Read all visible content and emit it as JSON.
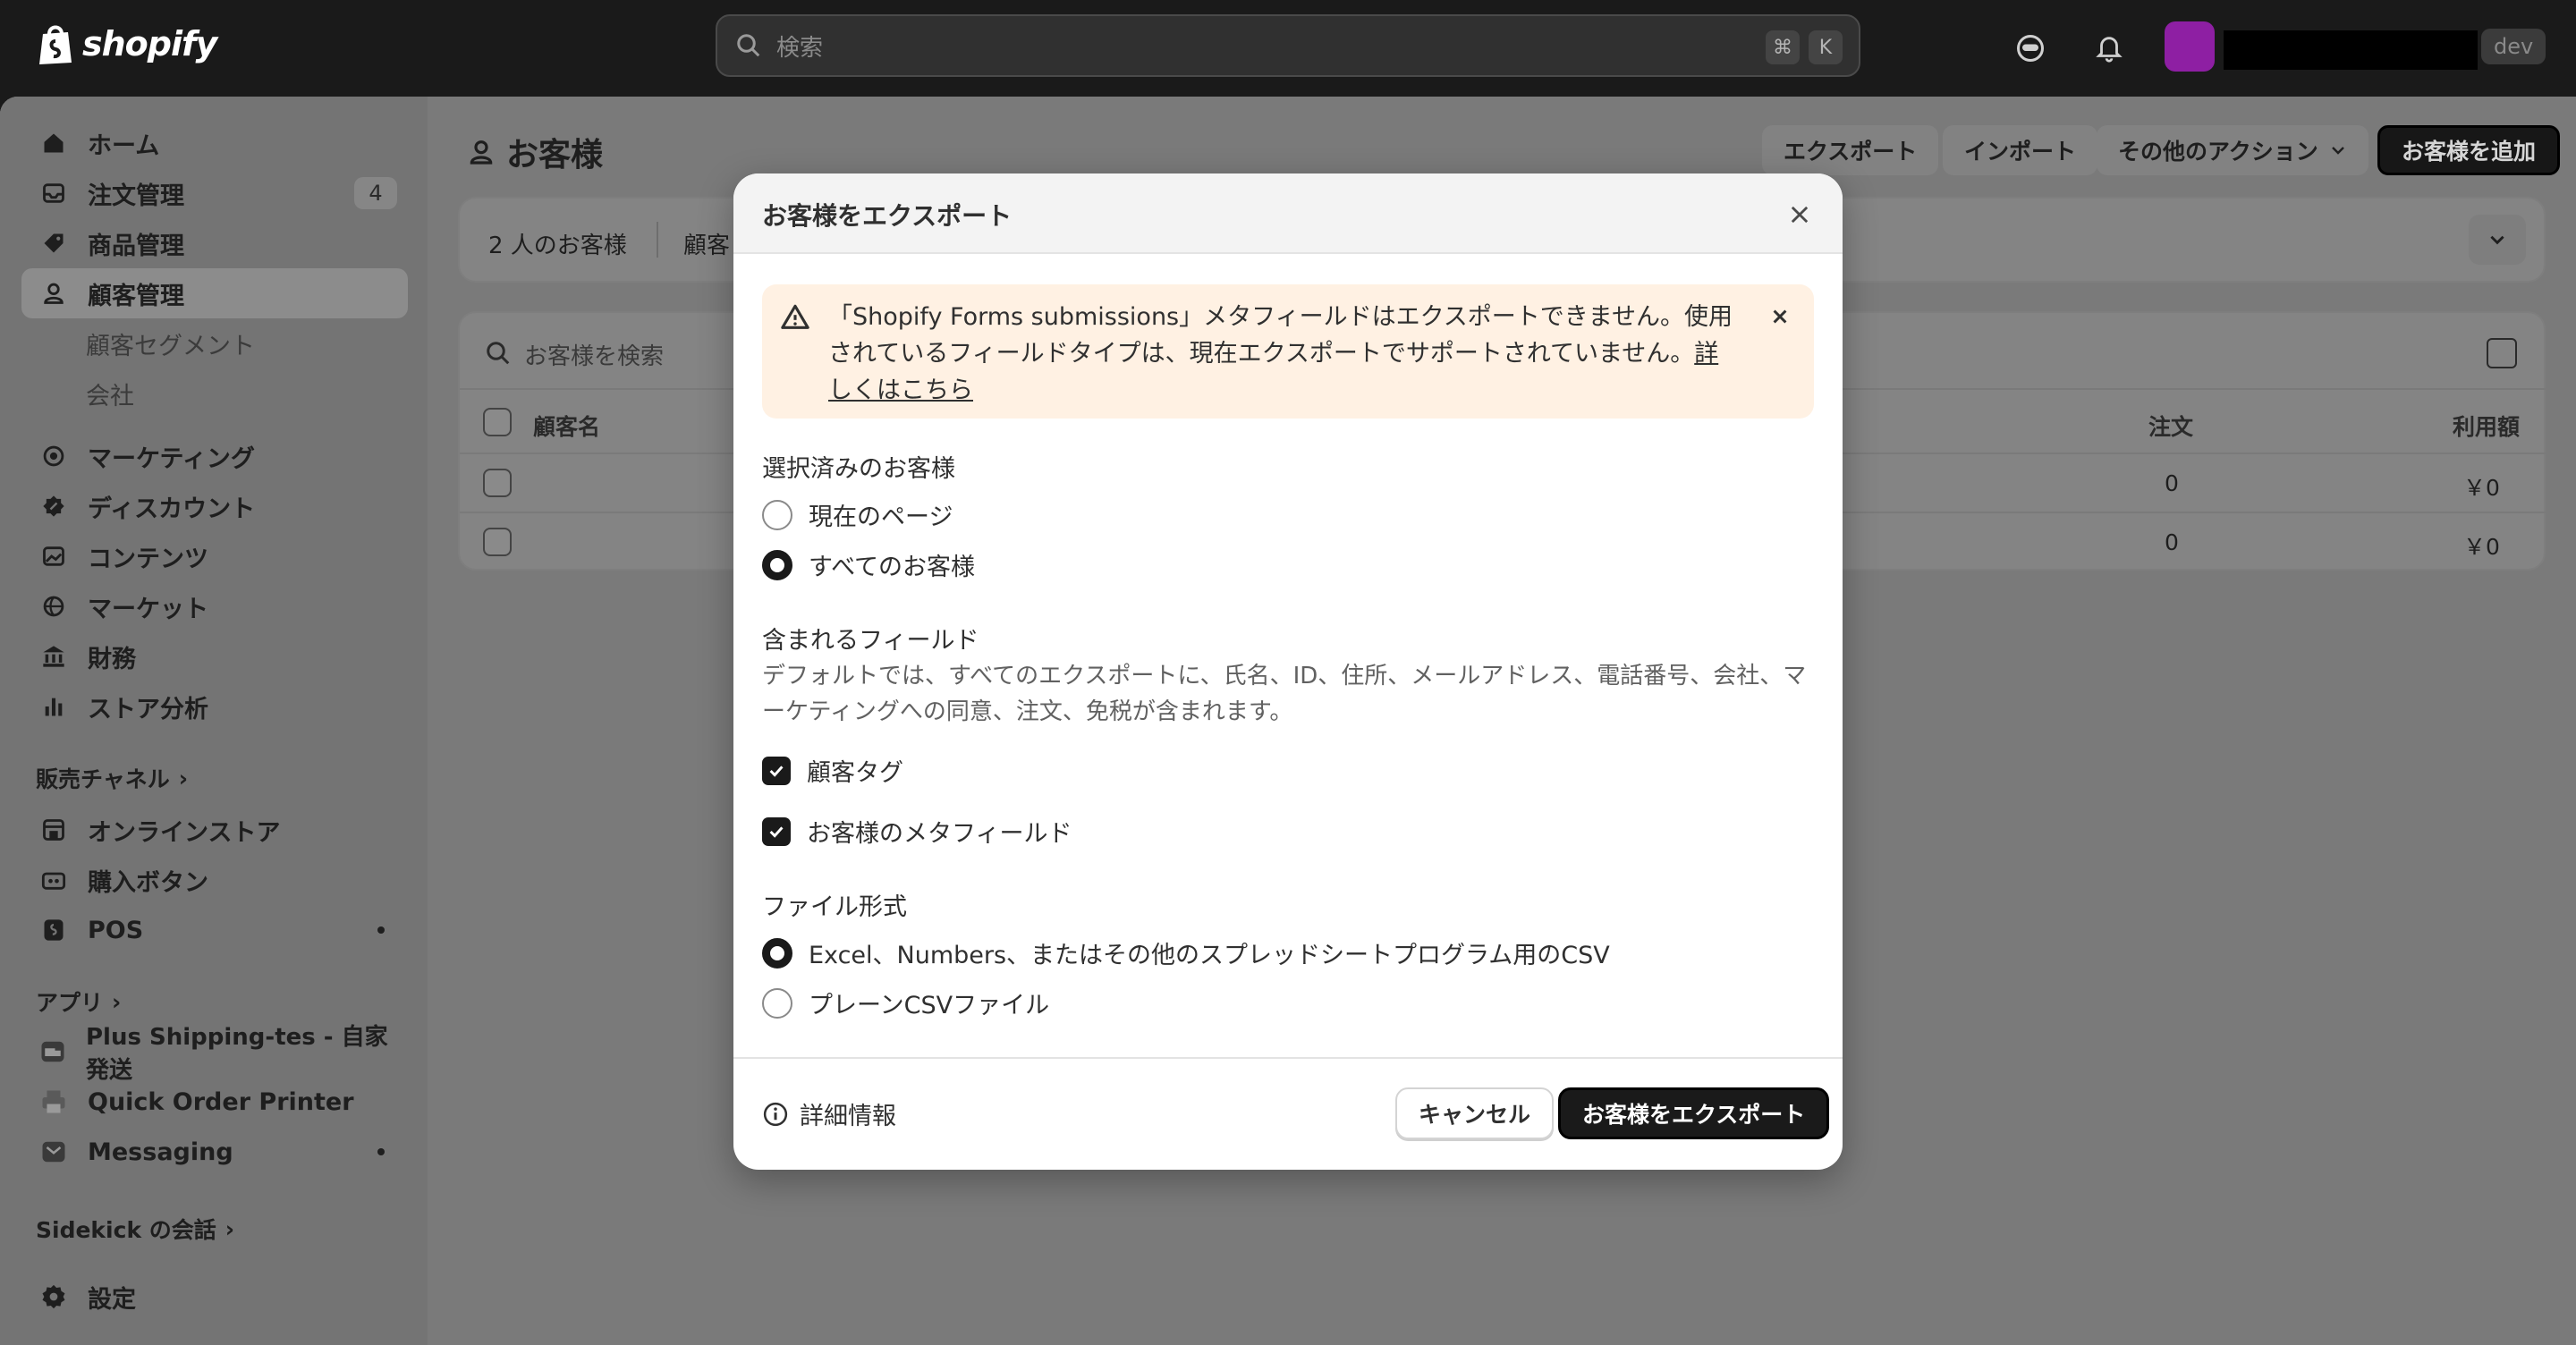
{
  "topbar": {
    "brand": "shopify",
    "search_placeholder": "検索",
    "shortcut_cmd": "⌘",
    "shortcut_key": "K",
    "store_badge": "dev"
  },
  "sidebar": {
    "items": [
      {
        "label": "ホーム",
        "icon": "home-icon"
      },
      {
        "label": "注文管理",
        "icon": "inbox-icon",
        "count": "4"
      },
      {
        "label": "商品管理",
        "icon": "tag-icon"
      },
      {
        "label": "顧客管理",
        "icon": "person-icon"
      },
      {
        "label": "顧客セグメント"
      },
      {
        "label": "会社"
      },
      {
        "label": "マーケティング",
        "icon": "target-icon"
      },
      {
        "label": "ディスカウント",
        "icon": "discount-icon"
      },
      {
        "label": "コンテンツ",
        "icon": "image-icon"
      },
      {
        "label": "マーケット",
        "icon": "globe-icon"
      },
      {
        "label": "財務",
        "icon": "bank-icon"
      },
      {
        "label": "ストア分析",
        "icon": "chart-icon"
      }
    ],
    "sales_channels_heading": "販売チャネル",
    "sales_channels": [
      {
        "label": "オンラインストア",
        "icon": "store-icon"
      },
      {
        "label": "購入ボタン",
        "icon": "buy-button-icon"
      },
      {
        "label": "POS",
        "icon": "pos-icon"
      }
    ],
    "apps_heading": "アプリ",
    "apps": [
      {
        "label": "Plus Shipping-tes - 自家発送",
        "icon": "shipping-app-icon"
      },
      {
        "label": "Quick Order Printer",
        "icon": "printer-icon"
      },
      {
        "label": "Messaging",
        "icon": "messaging-icon"
      }
    ],
    "sidekick_heading": "Sidekick の会話",
    "settings_label": "設定"
  },
  "page": {
    "title": "お客様",
    "export_label": "エクスポート",
    "import_label": "インポート",
    "more_actions_label": "その他のアクション",
    "add_customer_label": "お客様を追加",
    "customer_count": "2 人のお客様",
    "segment_partial": "顧客",
    "search_placeholder": "お客様を検索",
    "columns": {
      "name": "顧客名",
      "orders": "注文",
      "spent": "利用額"
    },
    "rows": [
      {
        "orders": "0",
        "spent": "￥0"
      },
      {
        "orders": "0",
        "spent": "￥0"
      }
    ]
  },
  "modal": {
    "title": "お客様をエクスポート",
    "warning_text": "「Shopify Forms submissions」メタフィールドはエクスポートできません。使用されているフィールドタイプは、現在エクスポートでサポートされていません。",
    "warning_link": "詳しくはこちら",
    "selected_customers_label": "選択済みのお客様",
    "opt_current_page": "現在のページ",
    "opt_all_customers": "すべてのお客様",
    "included_fields_label": "含まれるフィールド",
    "included_fields_help": "デフォルトでは、すべてのエクスポートに、氏名、ID、住所、メールアドレス、電話番号、会社、マーケティングへの同意、注文、免税が含まれます。",
    "chk_customer_tags": "顧客タグ",
    "chk_customer_metafields": "お客様のメタフィールド",
    "file_format_label": "ファイル形式",
    "opt_csv_excel": "Excel、Numbers、またはその他のスプレッドシートプログラム用のCSV",
    "opt_plain_csv": "プレーンCSVファイル",
    "more_info": "詳細情報",
    "cancel_label": "キャンセル",
    "export_label": "お客様をエクスポート"
  },
  "colors": {
    "banner_bg": "#fff1e3",
    "primary": "#1a1a1a",
    "avatar": "#8e1fa3"
  }
}
